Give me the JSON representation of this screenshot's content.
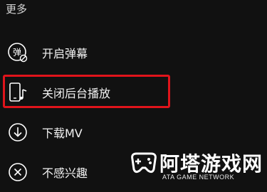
{
  "sheet": {
    "title": "更多"
  },
  "menu": [
    {
      "label": "开启弹幕",
      "icon": "danmaku-icon",
      "icon_glyph": "弹"
    },
    {
      "label": "关闭后台播放",
      "icon": "background-play-icon"
    },
    {
      "label": "下载MV",
      "icon": "download-icon"
    },
    {
      "label": "不感兴趣",
      "icon": "not-interested-icon"
    }
  ],
  "highlight": {
    "color": "#e0141b",
    "target": "关闭后台播放"
  },
  "watermark": {
    "title": "阿塔游戏网",
    "subtitle": "ATA GAME NETWORK"
  }
}
